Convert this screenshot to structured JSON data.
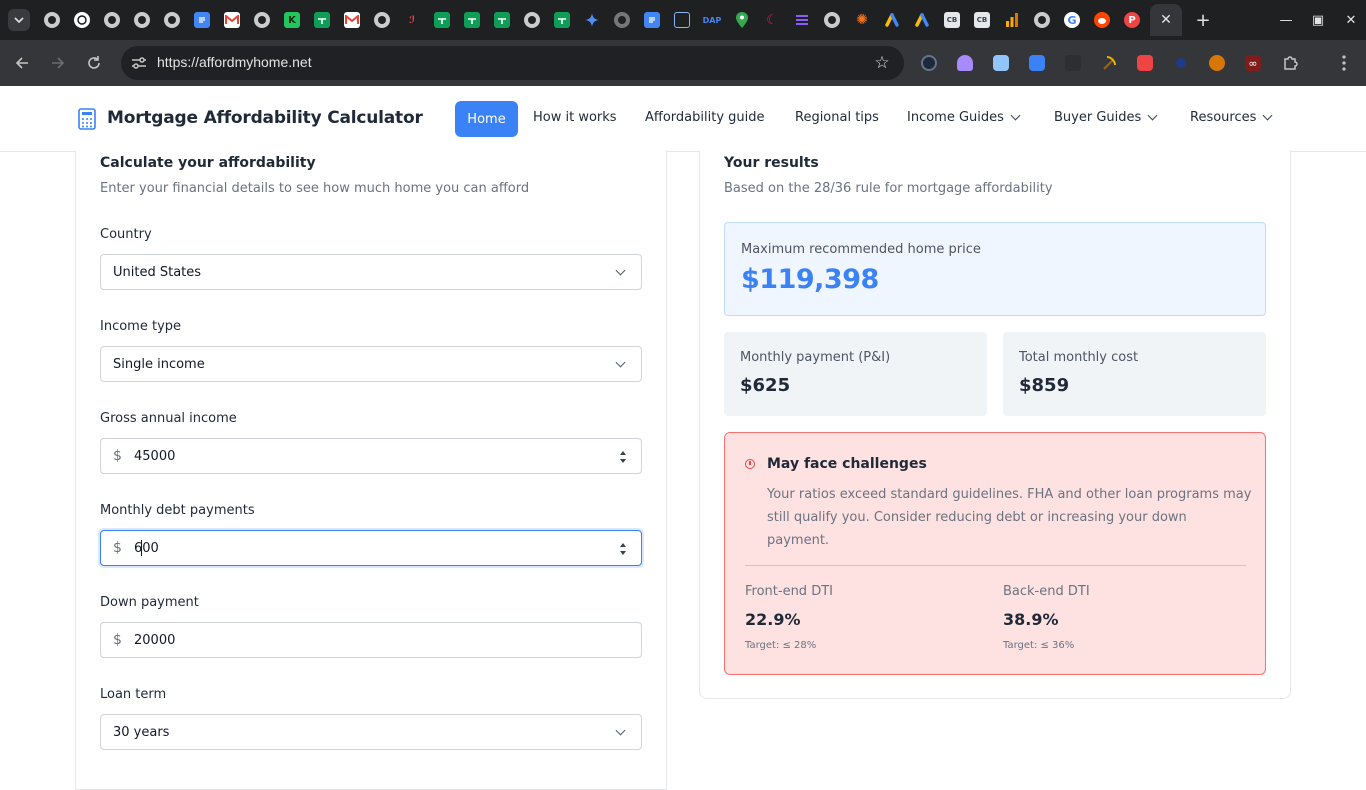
{
  "browser": {
    "url": "https://affordmyhome.net",
    "tabs": [
      {
        "icon": "globe-icon"
      },
      {
        "icon": "openai-icon"
      },
      {
        "icon": "globe-icon"
      },
      {
        "icon": "globe-icon"
      },
      {
        "icon": "globe-icon"
      },
      {
        "icon": "google-docs-icon"
      },
      {
        "icon": "gmail-icon"
      },
      {
        "icon": "globe-icon"
      },
      {
        "icon": "k-icon"
      },
      {
        "icon": "google-sheets-icon"
      },
      {
        "icon": "gmail-icon"
      },
      {
        "icon": "globe-icon"
      },
      {
        "icon": "script-icon"
      },
      {
        "icon": "google-sheets-icon"
      },
      {
        "icon": "google-sheets-icon"
      },
      {
        "icon": "google-sheets-icon"
      },
      {
        "icon": "globe-icon"
      },
      {
        "icon": "google-sheets-icon"
      },
      {
        "icon": "gemini-icon"
      },
      {
        "icon": "globe-icon"
      },
      {
        "icon": "google-docs-icon"
      },
      {
        "icon": "display-icon"
      },
      {
        "icon": "dap-icon"
      },
      {
        "icon": "maps-icon"
      },
      {
        "icon": "moon-icon"
      },
      {
        "icon": "stack-icon"
      },
      {
        "icon": "globe-icon"
      },
      {
        "icon": "claude-icon"
      },
      {
        "icon": "google-ads-icon"
      },
      {
        "icon": "google-ads-icon"
      },
      {
        "icon": "cb-icon"
      },
      {
        "icon": "cb-icon"
      },
      {
        "icon": "analytics-icon"
      },
      {
        "icon": "globe-icon"
      },
      {
        "icon": "google-icon"
      },
      {
        "icon": "reddit-icon"
      },
      {
        "icon": "p-icon"
      }
    ],
    "dap_text": "DAP",
    "cb_text": "CB",
    "k_text": "K",
    "p_text": "P",
    "extensions": [
      "clock-ext-icon",
      "ghost-ext-icon",
      "image-ext-icon",
      "book-ext-icon",
      "blank-ext-icon",
      "pickaxe-ext-icon",
      "pocket-ext-icon",
      "blank-ext-icon",
      "cookie-ext-icon",
      "infinity-ext-icon",
      "puzzle-icon",
      "kebab-menu-icon"
    ]
  },
  "site": {
    "title": "Mortgage Affordability Calculator",
    "nav": {
      "home": "Home",
      "how_it_works": "How it works",
      "guide": "Affordability guide",
      "regional": "Regional tips",
      "income_guides": "Income Guides",
      "buyer_guides": "Buyer Guides",
      "resources": "Resources"
    }
  },
  "calculator": {
    "title": "Calculate your affordability",
    "subtitle": "Enter your financial details to see how much home you can afford",
    "fields": {
      "country": {
        "label": "Country",
        "value": "United States"
      },
      "income_type": {
        "label": "Income type",
        "value": "Single income"
      },
      "gross_income": {
        "label": "Gross annual income",
        "currency": "$",
        "value": "45000"
      },
      "monthly_debt": {
        "label": "Monthly debt payments",
        "currency": "$",
        "value": "600"
      },
      "down_payment": {
        "label": "Down payment",
        "currency": "$",
        "value": "20000"
      },
      "loan_term": {
        "label": "Loan term",
        "value": "30 years"
      }
    }
  },
  "results": {
    "title": "Your results",
    "subtitle": "Based on the 28/36 rule for mortgage affordability",
    "max_price_label": "Maximum recommended home price",
    "max_price": "$119,398",
    "monthly_payment_label": "Monthly payment (P&I)",
    "monthly_payment": "$625",
    "total_monthly_label": "Total monthly cost",
    "total_monthly": "$859",
    "warning_title": "May face challenges",
    "warning_body": "Your ratios exceed standard guidelines. FHA and other loan programs may still qualify you. Consider reducing debt or increasing your down payment.",
    "front_dti_label": "Front-end DTI",
    "front_dti": "22.9%",
    "front_dti_target": "Target: ≤ 28%",
    "back_dti_label": "Back-end DTI",
    "back_dti": "38.9%",
    "back_dti_target": "Target: ≤ 36%"
  },
  "colors": {
    "accent": "#3b82f6",
    "warning_bg": "#fee2e2",
    "warning_border": "#f87171",
    "price_bg": "#eff6ff"
  }
}
